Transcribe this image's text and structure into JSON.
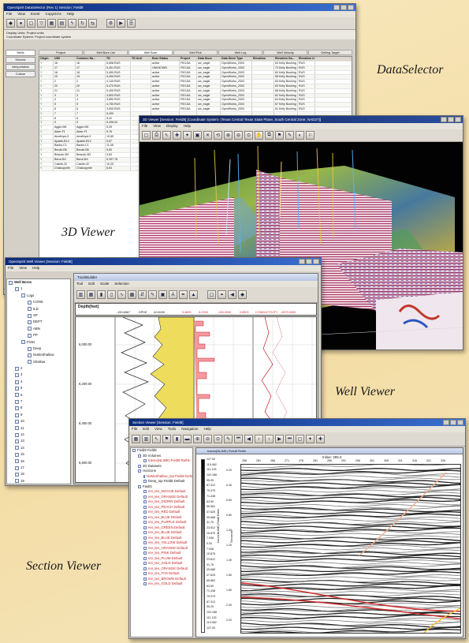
{
  "captions": {
    "data_selector": "DataSelector",
    "viewer_3d": "3D Viewer",
    "well_viewer": "Well Viewer",
    "section_viewer": "Section Viewer"
  },
  "data_selector": {
    "title": "OpenSpirit DataSelector (Rev 1) Session: Field8",
    "menu": [
      "File",
      "View",
      "Event",
      "CopyGrns",
      "Help"
    ],
    "info": [
      "Display Units: Project units",
      "Coordinate System: Project coordinate system"
    ],
    "side_tabs": [
      "Wells",
      "Seismic",
      "Interpretation",
      "Culture"
    ],
    "tabs": [
      "Project",
      "Well Bore List",
      "Well Bore",
      "Well Pick",
      "Well Log",
      "Well Velocity",
      "Drilling Target"
    ],
    "columns": [
      "Origin",
      "UWI",
      "Common Na...",
      "TD",
      "TD Unit",
      "Bore Status",
      "Project",
      "Data Store",
      "Data Store Type",
      "Elevation",
      "Elevation Da...",
      "Elevation Unit"
    ],
    "rows": [
      [
        "Y",
        "16",
        "16",
        "5,898.RUS",
        "",
        "active",
        "FIELDA",
        "ow_eagle",
        "OpenWorks_2003",
        "",
        "63 Kelly Bushing",
        "RUS"
      ],
      [
        "Y",
        "17",
        "17",
        "5,451.RUS",
        "",
        "UNKNOWN",
        "FIELDA",
        "ow_eagle",
        "OpenWorks_2003",
        "",
        "73 Kelly Bushing",
        "RUS"
      ],
      [
        "Y",
        "18",
        "18",
        "5,450.RUS",
        "",
        "active",
        "FIELDA",
        "ow_eagle",
        "OpenWorks_2003",
        "",
        "60 Kelly Bushing",
        "RUS"
      ],
      [
        "Y",
        "19",
        "19",
        "5,450.RUS",
        "",
        "active",
        "FIELDA",
        "ow_eagle",
        "OpenWorks_2003",
        "",
        "58 Kelly Bushing",
        "RUS"
      ],
      [
        "Y",
        "2",
        "2",
        "4,140.RUS",
        "",
        "active",
        "FIELDA",
        "ow_eagle",
        "OpenWorks_2003",
        "",
        "63 Kelly Bushing",
        "RUS"
      ],
      [
        "Y",
        "20",
        "20",
        "5,470.RUS",
        "",
        "active",
        "FIELDA",
        "ow_eagle",
        "OpenWorks_2003",
        "",
        "60 Kelly Bushing",
        "RUS"
      ],
      [
        "Y",
        "21",
        "21",
        "5,400.RUS",
        "",
        "active",
        "FIELDA",
        "ow_eagle",
        "OpenWorks_2003",
        "",
        "68 Kelly Bushing",
        "RUS"
      ],
      [
        "Y",
        "3",
        "3",
        "3,800.RUS",
        "",
        "active",
        "FIELDA",
        "ow_eagle",
        "OpenWorks_2003",
        "",
        "62 Kelly Bushing",
        "RUS"
      ],
      [
        "Y",
        "4",
        "4",
        "3,850.RUS",
        "",
        "active",
        "FIELDA",
        "ow_eagle",
        "OpenWorks_2003",
        "",
        "64 Kelly Bushing",
        "RUS"
      ],
      [
        "Y",
        "5",
        "5",
        "4,750.RUS",
        "",
        "active",
        "FIELDA",
        "ow_eagle",
        "OpenWorks_2003",
        "",
        "67 Kelly Bushing",
        "RUS"
      ],
      [
        "Y",
        "6",
        "6",
        "3,900.RUS",
        "",
        "active",
        "FIELDA",
        "ow_eagle",
        "OpenWorks_2003",
        "",
        "61 Kelly Bushing",
        "RUS"
      ],
      [
        "Y",
        "7",
        "7",
        "5,400",
        "",
        "",
        "",
        "",
        "",
        "",
        "",
        ""
      ],
      [
        "Y",
        "8",
        "8",
        "5,42",
        "",
        "",
        "",
        "",
        "",
        "",
        "",
        ""
      ],
      [
        "Y",
        "9",
        "9",
        "5,498.94",
        "",
        "",
        "",
        "",
        "",
        "",
        "",
        ""
      ],
      [
        "Y",
        "Aggie-M6",
        "Aggie-M6",
        "5,25",
        "",
        "",
        "",
        "",
        "",
        "",
        "",
        ""
      ],
      [
        "Y",
        "Alder-F1",
        "Alder-F1",
        "5,76",
        "",
        "",
        "",
        "",
        "",
        "",
        "",
        ""
      ],
      [
        "Y",
        "Amethyst-3",
        "Amethyst-3",
        "10,69",
        "",
        "",
        "",
        "",
        "",
        "",
        "",
        ""
      ],
      [
        "Y",
        "Apalite-B13",
        "Apalite-B13",
        "5,67",
        "",
        "",
        "",
        "",
        "",
        "",
        "",
        ""
      ],
      [
        "Y",
        "Banks-C1",
        "Banks-C1",
        "11,38",
        "",
        "",
        "",
        "",
        "",
        "",
        "",
        ""
      ],
      [
        "Y",
        "Becab-B6",
        "Becab-B6",
        "5,83",
        "",
        "",
        "",
        "",
        "",
        "",
        "",
        ""
      ],
      [
        "Y",
        "Beaudo-B3",
        "Beaudo-B3",
        "5,63",
        "",
        "",
        "",
        "",
        "",
        "",
        "",
        ""
      ],
      [
        "Y",
        "Benzi-B4",
        "Benzi-B4",
        "5,397.78",
        "",
        "",
        "",
        "",
        "",
        "",
        "",
        ""
      ],
      [
        "Y",
        "Calcite-32",
        "Calcite-32",
        "10,25",
        "",
        "",
        "",
        "",
        "",
        "",
        "",
        ""
      ],
      [
        "Y",
        "Chalcopyrite",
        "Chalcopyrite",
        "6,64",
        "",
        "",
        "",
        "",
        "",
        "",
        "",
        ""
      ]
    ],
    "status": "All Well Bores retrieved"
  },
  "viewer_3d": {
    "title": "3D Viewer [Session: Field8] [Coordinate System: (Texas Central Texas State Plane, South Central Zone, NAD27)]",
    "menu": [
      "File",
      "View",
      "Display",
      "Help"
    ]
  },
  "well_viewer": {
    "title": "OpenSpirit Well Viewer [Session: Field8]",
    "menu": [
      "File",
      "View",
      "Help"
    ],
    "tree": {
      "root": "Well Bores",
      "logs_label": "Logs",
      "logs": [
        "COND",
        "ILD",
        "SP",
        "DEPT",
        "ABN",
        "PP"
      ],
      "picks_label": "Picks",
      "picks": [
        "Deep",
        "NoMoShallow",
        "Shallow"
      ],
      "wells": [
        "1",
        "2",
        "3",
        "4",
        "5",
        "6",
        "7",
        "8",
        "9",
        "10",
        "11",
        "12",
        "13",
        "14",
        "15",
        "16",
        "17",
        "18",
        "19",
        "20",
        "21",
        "Well-S-47-2",
        "OCS-G-02056 #1"
      ]
    },
    "inner_title": "TrackBuilder",
    "inner_menu": [
      "Tool",
      "Edit",
      "Scale",
      "Selection"
    ],
    "depth_header": "Depth(feet)",
    "header_values": [
      "-153.6567",
      "DPDE",
      "-40.8430",
      "5.4800",
      "-5.2000",
      "-105.0000",
      "0.8500",
      "CONDUCTIVITY",
      "-4570.0000"
    ],
    "depth_ticks": [
      "6,000.00",
      "6,200.00",
      "6,400.00",
      "6,600.00"
    ]
  },
  "section_viewer": {
    "title": "Section Viewer [Session: Field8]",
    "menu": [
      "File",
      "Edit",
      "View",
      "Tools",
      "Navigation",
      "Help"
    ],
    "tree": {
      "root": "Field8 Field8",
      "items": [
        {
          "label": "3D Volumes",
          "red": false,
          "depth": 1
        },
        {
          "label": "traces(NLIME) Field8 Relbk",
          "red": true,
          "depth": 2
        },
        {
          "label": "2D Datasets",
          "red": false,
          "depth": 1
        },
        {
          "label": "Horizons",
          "red": false,
          "depth": 1
        },
        {
          "label": "NoMoShallow_top Field8 Default",
          "red": true,
          "depth": 2
        },
        {
          "label": "Deep_top Field8 Default",
          "red": false,
          "depth": 2
        },
        {
          "label": "Faults",
          "red": false,
          "depth": 1
        },
        {
          "label": "rev_tes_MOGUE Default",
          "red": true,
          "depth": 2
        },
        {
          "label": "rev_tes_ORANGE Default",
          "red": true,
          "depth": 2
        },
        {
          "label": "rev_tes_DIGRIN Default",
          "red": true,
          "depth": 2
        },
        {
          "label": "rev_tes_PEACH Default",
          "red": true,
          "depth": 2
        },
        {
          "label": "rev_tes_RED Default",
          "red": true,
          "depth": 2
        },
        {
          "label": "rev_tes_BLUE Default",
          "red": true,
          "depth": 2
        },
        {
          "label": "rev_tes_PURPLE Default",
          "red": true,
          "depth": 2
        },
        {
          "label": "rev_tes_GREEN Default",
          "red": true,
          "depth": 2
        },
        {
          "label": "rev_tes_BLUE Default",
          "red": true,
          "depth": 2
        },
        {
          "label": "rev_tes_BLUE Default",
          "red": true,
          "depth": 2
        },
        {
          "label": "rev_tes_YELLOW Default",
          "red": true,
          "depth": 2
        },
        {
          "label": "rev_tes_ORANGE Default",
          "red": true,
          "depth": 2
        },
        {
          "label": "rev_tes_PINK Default",
          "red": true,
          "depth": 2
        },
        {
          "label": "rev_tes_PLUM Default",
          "red": true,
          "depth": 2
        },
        {
          "label": "rev_tes_GOLD Default",
          "red": true,
          "depth": 2
        },
        {
          "label": "rev_tes_ORANGE Default",
          "red": true,
          "depth": 2
        },
        {
          "label": "rev_tes_TAN Default",
          "red": true,
          "depth": 2
        },
        {
          "label": "rev_tes_BROWN Default",
          "red": true,
          "depth": 2
        },
        {
          "label": "rev_tes_GOLD Default",
          "red": true,
          "depth": 2
        }
      ]
    },
    "panel_title": "traces(NLIME) Field8 Relbk",
    "inline_label": "Inline: 255.0",
    "xline_ticks": [
      "256",
      "261",
      "266",
      "271",
      "276",
      "281",
      "286",
      "291",
      "296",
      "301",
      "306",
      "311",
      "316",
      "321",
      "326"
    ],
    "time_ticks": [
      "0.20",
      "0.40",
      "0.60",
      "0.80",
      "1.00",
      "1.20",
      "1.40",
      "1.60",
      "1.80",
      "2.00",
      "2.20"
    ],
    "colorbar_values": [
      "127.00",
      "119.062",
      "111.125",
      "103.188",
      "95.25",
      "87.312",
      "79.375",
      "71.438",
      "63.50",
      "55.562",
      "47.625",
      "39.688",
      "31.75",
      "23.812",
      "15.875",
      "7.938",
      "0.00",
      "7.938",
      "15.875",
      "23.812",
      "31.75",
      "39.688",
      "47.625",
      "55.562",
      "63.50",
      "71.438",
      "79.375",
      "87.312",
      "95.25",
      "103.188",
      "111.125",
      "119.062",
      "127.00"
    ],
    "colorbar_label": "traces(NLIME) Field8 Relbk",
    "axis_label": "Seconds"
  }
}
